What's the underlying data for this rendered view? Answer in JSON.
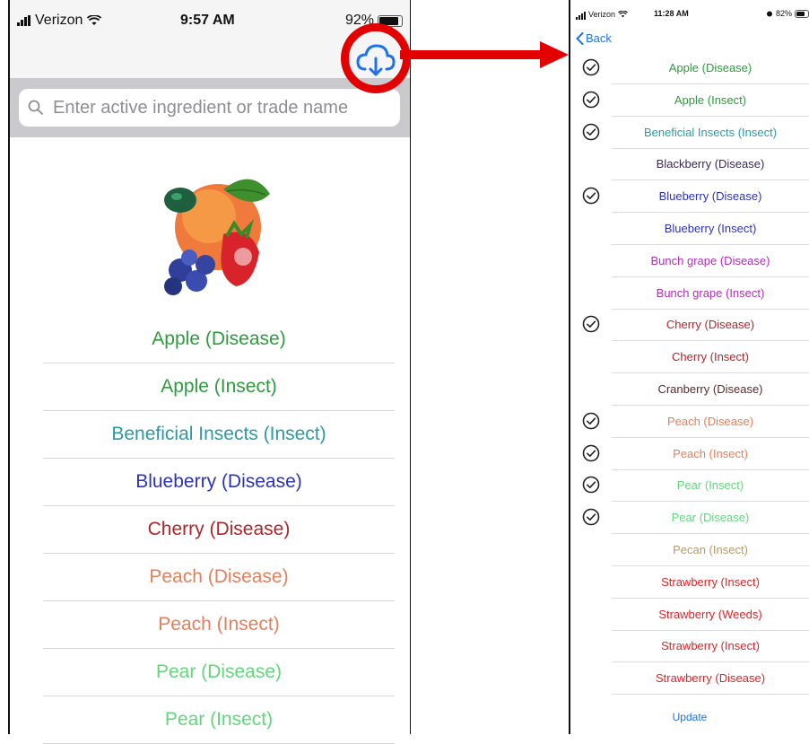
{
  "left_screen": {
    "status": {
      "carrier": "Verizon",
      "time": "9:57 AM",
      "battery": "92%"
    },
    "search": {
      "placeholder": "Enter active ingredient or trade name"
    },
    "items": [
      {
        "label": "Apple (Disease)",
        "color": "#2e9b3e"
      },
      {
        "label": "Apple (Insect)",
        "color": "#2e9b3e"
      },
      {
        "label": "Beneficial Insects (Insect)",
        "color": "#2b9aa3"
      },
      {
        "label": "Blueberry (Disease)",
        "color": "#2d33b5"
      },
      {
        "label": "Cherry (Disease)",
        "color": "#b0262a"
      },
      {
        "label": "Peach (Disease)",
        "color": "#e2805d"
      },
      {
        "label": "Peach (Insect)",
        "color": "#e2805d"
      },
      {
        "label": "Pear (Disease)",
        "color": "#63d67d"
      },
      {
        "label": "Pear (Insect)",
        "color": "#63d67d"
      }
    ]
  },
  "right_screen": {
    "status": {
      "carrier": "Verizon",
      "time": "11:28 AM",
      "battery": "82%"
    },
    "back_label": "Back",
    "items": [
      {
        "label": "Apple (Disease)",
        "color": "#2e9b3e",
        "downloaded": true
      },
      {
        "label": "Apple (Insect)",
        "color": "#2e9b3e",
        "downloaded": true
      },
      {
        "label": "Beneficial Insects (Insect)",
        "color": "#2b9aa3",
        "downloaded": true
      },
      {
        "label": "Blackberry (Disease)",
        "color": "#3a2a55",
        "downloaded": false
      },
      {
        "label": "Blueberry (Disease)",
        "color": "#2d33b5",
        "downloaded": true
      },
      {
        "label": "Blueberry (Insect)",
        "color": "#2d33b5",
        "downloaded": false
      },
      {
        "label": "Bunch grape (Disease)",
        "color": "#b02fb8",
        "downloaded": false
      },
      {
        "label": "Bunch grape (Insect)",
        "color": "#b02fb8",
        "downloaded": false
      },
      {
        "label": "Cherry (Disease)",
        "color": "#b0262a",
        "downloaded": true
      },
      {
        "label": "Cherry (Insect)",
        "color": "#b0262a",
        "downloaded": false
      },
      {
        "label": "Cranberry (Disease)",
        "color": "#5a2a2a",
        "downloaded": false
      },
      {
        "label": "Peach (Disease)",
        "color": "#e2805d",
        "downloaded": true
      },
      {
        "label": "Peach (Insect)",
        "color": "#e2805d",
        "downloaded": true
      },
      {
        "label": "Pear (Insect)",
        "color": "#63d67d",
        "downloaded": true
      },
      {
        "label": "Pear (Disease)",
        "color": "#63d67d",
        "downloaded": true
      },
      {
        "label": "Pecan (Insect)",
        "color": "#b59a6a",
        "downloaded": false
      },
      {
        "label": "Strawberry (Insect)",
        "color": "#d8262a",
        "downloaded": false
      },
      {
        "label": "Strawberry (Weeds)",
        "color": "#d8262a",
        "downloaded": false
      },
      {
        "label": "Strawberry (Insect)",
        "color": "#d8262a",
        "downloaded": false
      },
      {
        "label": "Strawberry (Disease)",
        "color": "#d8262a",
        "downloaded": false
      }
    ],
    "update_label": "Update"
  },
  "icons": {
    "download": "cloud-download-icon",
    "check": "checkmark-circle-icon",
    "search": "search-icon",
    "back": "chevron-left-icon"
  },
  "colors": {
    "annotation": "#e30000",
    "ios_blue": "#1e73e6"
  }
}
